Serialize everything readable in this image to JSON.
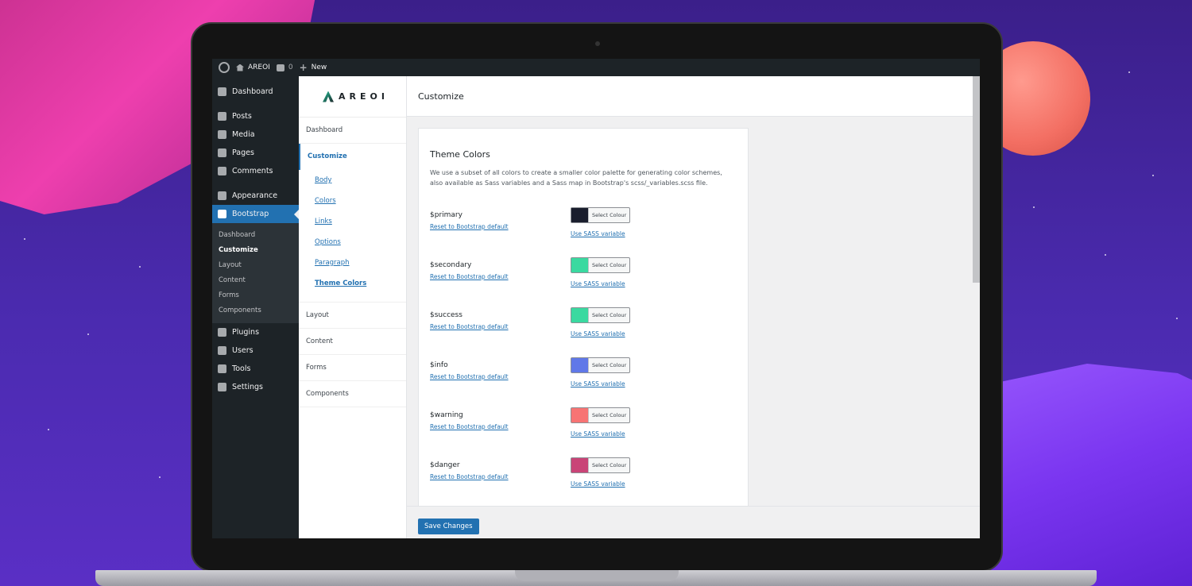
{
  "adminbar": {
    "site_name": "AREOI",
    "comments_count": "0",
    "new_label": "New"
  },
  "wpmenu": {
    "dashboard": "Dashboard",
    "posts": "Posts",
    "media": "Media",
    "pages": "Pages",
    "comments": "Comments",
    "appearance": "Appearance",
    "bootstrap": "Bootstrap",
    "bootstrap_sub": [
      "Dashboard",
      "Customize",
      "Layout",
      "Content",
      "Forms",
      "Components"
    ],
    "plugins": "Plugins",
    "users": "Users",
    "tools": "Tools",
    "settings": "Settings"
  },
  "panel": {
    "logo_text": "AREOI",
    "dashboard": "Dashboard",
    "customize": "Customize",
    "subs": [
      "Body",
      "Colors",
      "Links",
      "Options",
      "Paragraph",
      "Theme Colors"
    ],
    "layout": "Layout",
    "content": "Content",
    "forms": "Forms",
    "components": "Components"
  },
  "main": {
    "header": "Customize",
    "section_title": "Theme Colors",
    "description": "We use a subset of all colors to create a smaller color palette for generating color schemes, also available as Sass variables and a Sass map in Bootstrap's scss/_variables.scss file.",
    "picker_label": "Select Colour",
    "reset_label": "Reset to Bootstrap default",
    "sass_label": "Use SASS variable",
    "rows": [
      {
        "name": "$primary",
        "color": "#1a1e2d"
      },
      {
        "name": "$secondary",
        "color": "#3ad9a0"
      },
      {
        "name": "$success",
        "color": "#3ad9a0"
      },
      {
        "name": "$info",
        "color": "#6078e8"
      },
      {
        "name": "$warning",
        "color": "#f77474"
      },
      {
        "name": "$danger",
        "color": "#c94477"
      }
    ],
    "save_label": "Save Changes"
  }
}
